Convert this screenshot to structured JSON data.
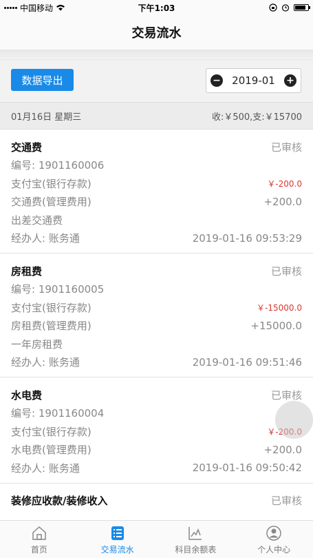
{
  "status_bar": {
    "carrier": "中国移动",
    "time": "下午1:03",
    "battery_level": 0.85
  },
  "nav": {
    "title": "交易流水"
  },
  "toolbar": {
    "export_label": "数据导出",
    "month": "2019-01",
    "prev_symbol": "−",
    "next_symbol": "+"
  },
  "day": {
    "date": "01月16日  星期三",
    "summary": "收:￥500,支:￥15700"
  },
  "records": [
    {
      "title": "交通费",
      "status": "已审核",
      "number": "编号:  1901160006",
      "debit_account": "支付宝(银行存款)",
      "debit_amount": "￥-200.0",
      "credit_account": "交通费(管理费用)",
      "credit_amount": "+200.0",
      "note": "出差交通费",
      "handler": "经办人:  账务通",
      "time": "2019-01-16 09:53:29"
    },
    {
      "title": "房租费",
      "status": "已审核",
      "number": "编号:  1901160005",
      "debit_account": "支付宝(银行存款)",
      "debit_amount": "￥-15000.0",
      "credit_account": "房租费(管理费用)",
      "credit_amount": "+15000.0",
      "note": "一年房租费",
      "handler": "经办人:  账务通",
      "time": "2019-01-16 09:51:46"
    },
    {
      "title": "水电费",
      "status": "已审核",
      "number": "编号:  1901160004",
      "debit_account": "支付宝(银行存款)",
      "debit_amount": "￥-200.0",
      "credit_account": "水电费(管理费用)",
      "credit_amount": "+200.0",
      "handler": "经办人:  账务通",
      "time": "2019-01-16 09:50:42"
    },
    {
      "title": "装修应收款/装修收入",
      "status": "已审核"
    }
  ],
  "tabs": [
    {
      "label": "首页",
      "icon": "home-icon",
      "active": false
    },
    {
      "label": "交易流水",
      "icon": "ledger-icon",
      "active": true
    },
    {
      "label": "科目余额表",
      "icon": "chart-icon",
      "active": false
    },
    {
      "label": "个人中心",
      "icon": "user-icon",
      "active": false
    }
  ],
  "colors": {
    "accent": "#1a8ae8",
    "negative": "#d9382c"
  }
}
